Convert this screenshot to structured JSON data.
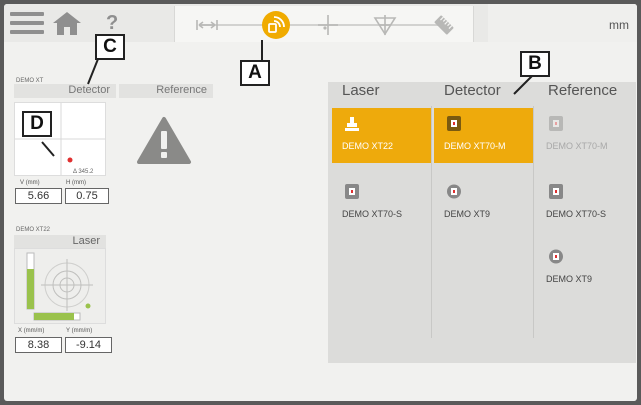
{
  "topbar": {
    "help_label": "?",
    "unit": "mm",
    "modes": [
      "distance-mode",
      "wireless-connect-mode",
      "crosshair-mode",
      "level-mode",
      "ruler-mode"
    ],
    "active_mode": "wireless-connect-mode",
    "accent_color": "#f0ab00"
  },
  "detector_panel": {
    "tag": "DEMO XT",
    "title": "Detector",
    "plot_marker_label": "Δ 345.2",
    "v_label": "V",
    "v_unit": "(mm)",
    "v_value": "5.66",
    "h_label": "H",
    "h_unit": "(mm)",
    "h_value": "0.75"
  },
  "reference_panel": {
    "title": "Reference",
    "status_icon": "warning-icon"
  },
  "laser_panel": {
    "tag": "DEMO XT22",
    "title": "Laser",
    "x_label": "X",
    "x_unit": "(mm/m)",
    "x_value": "8.38",
    "y_label": "Y",
    "y_unit": "(mm/m)",
    "y_value": "-9.14"
  },
  "device_table": {
    "headers": [
      "Laser",
      "Detector",
      "Reference"
    ],
    "laser": [
      {
        "label": "DEMO XT22",
        "state": "selected",
        "icon": "laser-device-icon"
      },
      {
        "label": "DEMO XT70-S",
        "state": "normal",
        "icon": "detector-device-icon"
      }
    ],
    "detector": [
      {
        "label": "DEMO XT70-M",
        "state": "selected",
        "icon": "detector-device-icon"
      },
      {
        "label": "DEMO XT9",
        "state": "normal",
        "icon": "round-detector-icon"
      }
    ],
    "reference": [
      {
        "label": "DEMO XT70-M",
        "state": "disabled",
        "icon": "detector-device-icon"
      },
      {
        "label": "DEMO XT70-S",
        "state": "normal",
        "icon": "detector-device-icon"
      },
      {
        "label": "DEMO XT9",
        "state": "normal",
        "icon": "round-detector-icon"
      }
    ]
  },
  "callouts": {
    "a": "A",
    "b": "B",
    "c": "C",
    "d": "D"
  }
}
